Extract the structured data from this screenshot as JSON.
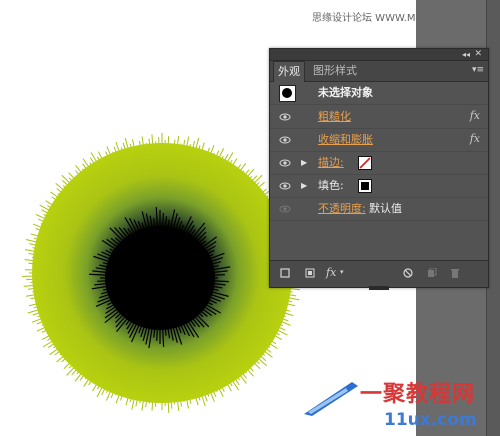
{
  "watermark_top": "思缘设计论坛 WWW.MISSYUAN.COM",
  "panel": {
    "tabs": [
      {
        "label": "外观",
        "active": true
      },
      {
        "label": "图形样式",
        "active": false
      }
    ],
    "header_row": {
      "label": "未选择对象"
    },
    "rows": [
      {
        "label": "粗糙化",
        "has_fx": true,
        "fx": "fx"
      },
      {
        "label": "收缩和膨胀",
        "has_fx": true,
        "fx": "fx"
      },
      {
        "label": "描边:",
        "swatch": "none-slash"
      },
      {
        "label": "填色:",
        "swatch": "black"
      },
      {
        "label": "不透明度:",
        "value": "默认值"
      }
    ],
    "bottom_fx_label": "fx"
  },
  "site_watermark": {
    "logo_text": "一聚教程网",
    "url_text": "11ux.com"
  },
  "colors": {
    "link": "#e7a04f",
    "lime": "#b3cc10",
    "panel_bg": "#535353"
  }
}
